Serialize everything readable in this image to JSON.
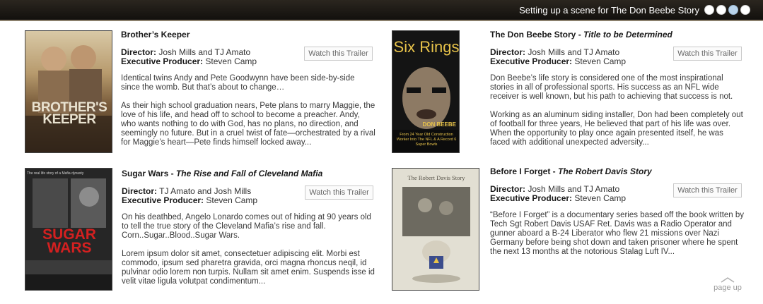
{
  "header": {
    "scene_text": "Setting up a scene for The Don Beebe Story",
    "dots": 4,
    "active_dot": 3
  },
  "trailer_label": "Watch this Trailer",
  "director_label": "Director:",
  "exec_label": "Executive Producer:",
  "movies": [
    {
      "title": "Brother’s Keeper",
      "subtitle": "",
      "director": "Josh Mills and TJ Amato",
      "exec_producer": "Steven Camp",
      "para1": "Identical twins Andy and Pete Goodwynn have been side-by-side since the womb. But that’s about to change…",
      "para2": "As their high school graduation nears, Pete plans to marry Maggie, the love of his life, and head off to school to become a preacher. Andy, who wants nothing to do with God, has no plans, no direction, and seemingly no future. But in a cruel twist of fate—orchestrated by a rival for Maggie’s heart—Pete finds himself locked away...",
      "poster_text": "BROTHER'S KEEPER"
    },
    {
      "title": "The Don Beebe Story",
      "subtitle": "Title to be Determined",
      "director": "Josh Mills and TJ Amato",
      "exec_producer": "Steven Camp",
      "para1": "Don Beebe’s life story is considered one of the most inspirational stories in all of professional sports.  His success as an NFL wide receiver is well known, but his path to achieving that success is not.",
      "para2": "Working as an aluminum siding installer, Don had been completely out of football for three years, He believed that part of his life was over. When the opportunity to play once again presented itself, he was faced with additional unexpected adversity...",
      "poster_text": "Six Rings",
      "poster_sub": "DON BEEBE",
      "poster_tag": "From 24 Year Old Construction Worker Into The NFL & A Record 6 Super Bowls"
    },
    {
      "title": "Sugar Wars",
      "subtitle": "The Rise and Fall of Cleveland Mafia",
      "director": "TJ Amato and Josh Mills",
      "exec_producer": "Steven Camp",
      "para1": "On his deathbed, Angelo Lonardo comes out of hiding at 90 years old to tell the true story of the Cleveland Mafia’s rise and fall. Corn..Sugar..Blood..Sugar Wars.",
      "para2": "Lorem ipsum dolor sit amet, consectetuer adipiscing elit. Morbi est commodo, ipsum sed pharetra gravida, orci magna rhoncus neqil, id pulvinar odio lorem non turpis. Nullam sit amet enim. Suspends isse id velit vitae ligula volutpat condimentum...",
      "poster_text": "SUGAR WARS",
      "poster_top": "The real life story of a Mafia dynasty"
    },
    {
      "title": "Before I Forget",
      "subtitle": "The Robert Davis Story",
      "director": "Josh Mills and TJ Amato",
      "exec_producer": "Steven Camp",
      "para1": "“Before I Forget” is a documentary series based off the book written by Tech Sgt Robert Davis USAF Ret. Davis was a Radio Operator and gunner aboard a B-24 Liberator who flew 21 missions over Nazi Germany before being shot down and taken prisoner where he spent the next 13 months at the notorious Stalag Luft IV...",
      "para2": "",
      "poster_text": "The Robert Davis Story"
    }
  ],
  "pageup_label": "page up"
}
